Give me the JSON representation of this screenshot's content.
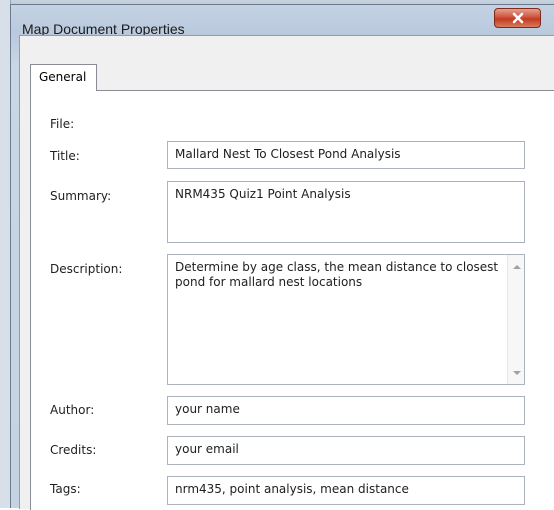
{
  "window": {
    "title": "Map Document Properties"
  },
  "tabs": [
    {
      "label": "General",
      "selected": true
    }
  ],
  "form": {
    "file_label": "File:",
    "title_label": "Title:",
    "title_value": "Mallard Nest To Closest Pond Analysis",
    "summary_label": "Summary:",
    "summary_value": "NRM435 Quiz1 Point Analysis",
    "description_label": "Description:",
    "description_value": "Determine by age class, the mean distance to closest pond for mallard nest locations",
    "author_label": "Author:",
    "author_value": "your name",
    "credits_label": "Credits:",
    "credits_value": "your email",
    "tags_label": "Tags:",
    "tags_value": "nrm435, point analysis, mean distance"
  },
  "icons": {
    "close": "close-icon",
    "scroll_up": "scroll-up-arrow-icon",
    "scroll_down": "scroll-down-arrow-icon"
  },
  "colors": {
    "close_button": "#c9442b",
    "window_frame": "#bfcfe1",
    "panel": "#ffffff"
  }
}
